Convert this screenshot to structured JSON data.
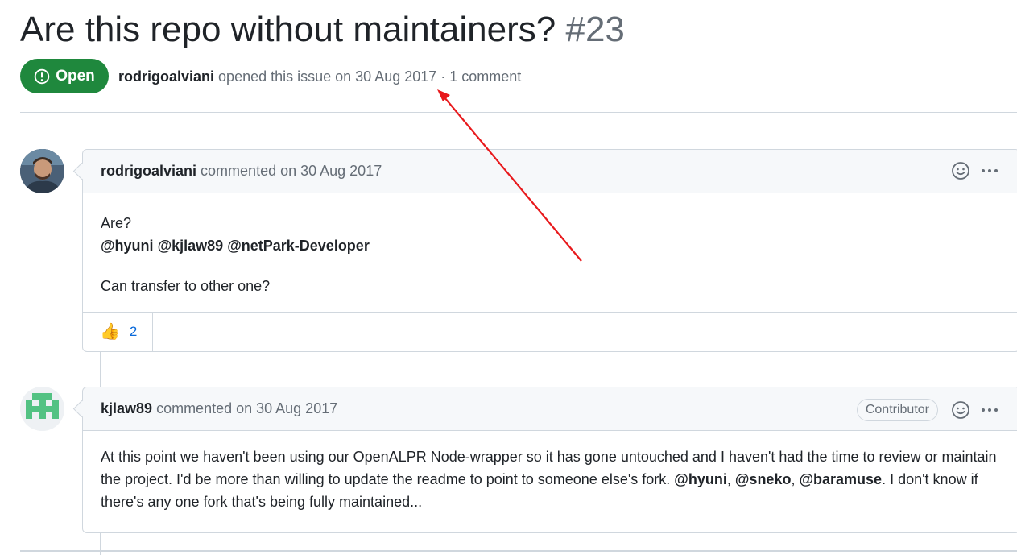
{
  "issue": {
    "title": "Are this repo without maintainers?",
    "number": "#23",
    "state": "Open",
    "author": "rodrigoalviani",
    "meta_text": "opened this issue on 30 Aug 2017 · 1 comment"
  },
  "comments": [
    {
      "author": "rodrigoalviani",
      "action": "commented on 30 Aug 2017",
      "body_line1": "Are?",
      "mentions": [
        "@hyuni",
        "@kjlaw89",
        "@netPark-Developer"
      ],
      "body_line3": "Can transfer to other one?",
      "reaction_emoji": "👍",
      "reaction_count": "2"
    },
    {
      "author": "kjlaw89",
      "action": "commented on 30 Aug 2017",
      "badge": "Contributor",
      "body_part1": "At this point we haven't been using our OpenALPR Node-wrapper so it has gone untouched and I haven't had the time to review or maintain the project. I'd be more than willing to update the readme to point to someone else's fork. ",
      "mention1": "@hyuni",
      "sep1": ", ",
      "mention2": "@sneko",
      "sep2": ", ",
      "mention3": "@baramuse",
      "body_part2": ". I don't know if there's any one fork that's being fully maintained..."
    }
  ],
  "annotation": {
    "arrow_color": "#e8191c"
  },
  "icons": [
    "issue-opened-icon",
    "smiley-icon",
    "kebab-horizontal-icon",
    "thumbs-up-icon"
  ],
  "colors": {
    "open_green": "#1f883d",
    "link_blue": "#0969da",
    "muted": "#656d76",
    "border": "#d0d7de"
  }
}
